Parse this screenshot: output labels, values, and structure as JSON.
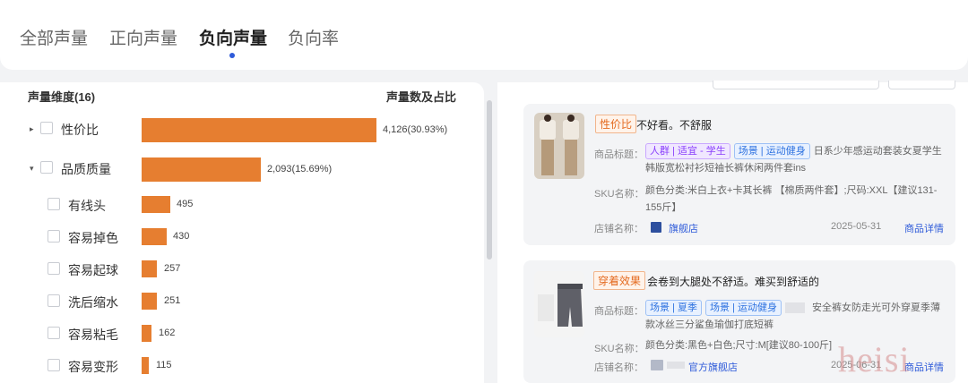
{
  "tabs": [
    {
      "label": "全部声量"
    },
    {
      "label": "正向声量"
    },
    {
      "label": "负向声量"
    },
    {
      "label": "负向率"
    }
  ],
  "active_tab": "负向声量",
  "left": {
    "dimension_header": "声量维度(16)",
    "value_header": "声量数及占比",
    "rows": [
      {
        "label": "性价比",
        "value": "4,126(30.93%)",
        "count": 4126,
        "level": 0,
        "arrow": "▸"
      },
      {
        "label": "品质质量",
        "value": "2,093(15.69%)",
        "count": 2093,
        "level": 0,
        "arrow": "▾"
      },
      {
        "label": "有线头",
        "value": "495",
        "count": 495,
        "level": 1
      },
      {
        "label": "容易掉色",
        "value": "430",
        "count": 430,
        "level": 1
      },
      {
        "label": "容易起球",
        "value": "257",
        "count": 257,
        "level": 1
      },
      {
        "label": "洗后缩水",
        "value": "251",
        "count": 251,
        "level": 1
      },
      {
        "label": "容易粘毛",
        "value": "162",
        "count": 162,
        "level": 1
      },
      {
        "label": "容易变形",
        "value": "115",
        "count": 115,
        "level": 1
      }
    ]
  },
  "cards": [
    {
      "aspect_tag": "性价比",
      "review": "不好看。不舒服",
      "title_label": "商品标题：",
      "chips": [
        {
          "text": "人群 | 适宜 - 学生",
          "color": "purple"
        },
        {
          "text": "场景 | 运动健身",
          "color": "blue"
        }
      ],
      "title_text": "日系少年感运动套装女夏学生韩版宽松衬衫短袖长裤休闲两件套ins",
      "sku_label": "SKU名称：",
      "sku_text": "颜色分类:米白上衣+卡其长裤 【棉质两件套】;尺码:XXL【建议131-155斤】",
      "store_label": "店铺名称：",
      "store_name": "旗舰店",
      "date": "2025-05-31",
      "detail": "商品详情"
    },
    {
      "aspect_tag": "穿着效果",
      "review": "会卷到大腿处不舒适。难买到舒适的",
      "title_label": "商品标题：",
      "chips": [
        {
          "text": "场景 | 夏季",
          "color": "blue"
        },
        {
          "text": "场景 | 运动健身",
          "color": "blue"
        }
      ],
      "title_text": "安全裤女防走光可外穿夏季薄款冰丝三分鲨鱼瑜伽打底短裤",
      "sku_label": "SKU名称：",
      "sku_text": "颜色分类:黑色+白色;尺寸:M[建议80-100斤]",
      "store_label": "店铺名称：",
      "store_name": "官方旗舰店",
      "date": "2025-06-31",
      "detail": "商品详情"
    }
  ],
  "watermark": "heisi",
  "colors": {
    "bar": "#e67e30",
    "accent": "#2f5bd9"
  }
}
